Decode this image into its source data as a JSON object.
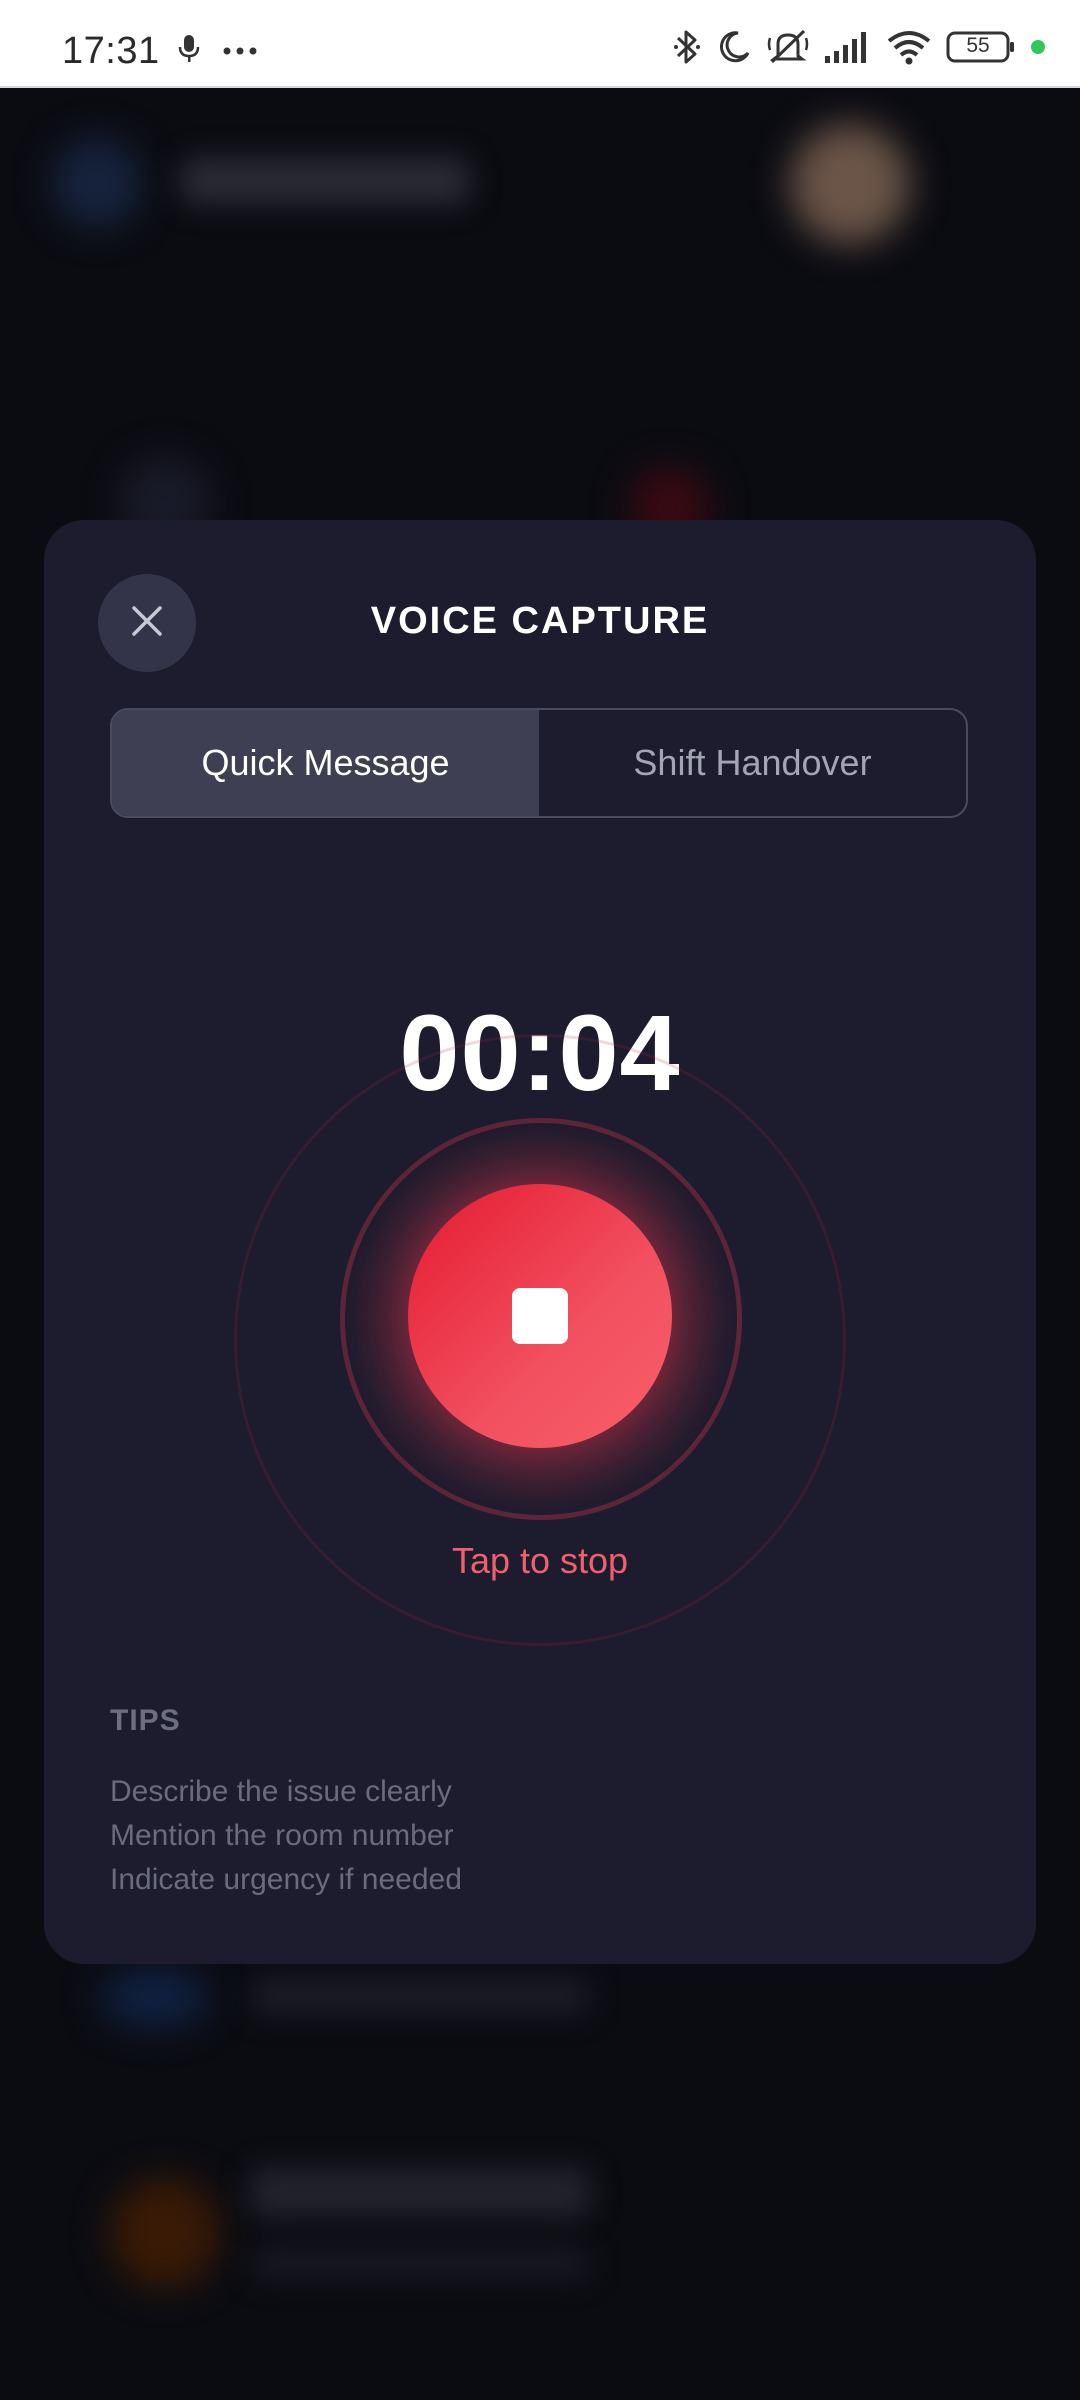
{
  "status_bar": {
    "time": "17:31",
    "battery": "55",
    "colors": {
      "indicator_dot": "#2fc95a"
    },
    "left_icons": [
      "microphone-icon",
      "more-dots-icon"
    ],
    "right_icons": [
      "bluetooth-icon",
      "moon-icon",
      "mute-icon",
      "signal-icon",
      "wifi-icon",
      "battery-icon"
    ]
  },
  "modal": {
    "title": "VOICE CAPTURE",
    "close_icon": "close-icon",
    "tabs": [
      {
        "label": "Quick Message",
        "active": true
      },
      {
        "label": "Shift Handover",
        "active": false
      }
    ],
    "timer": "00:04",
    "stop_icon": "stop-icon",
    "hint": "Tap to stop",
    "tips": {
      "title": "TIPS",
      "items": [
        "Describe the issue clearly",
        "Mention the room number",
        "Indicate urgency if needed"
      ]
    },
    "colors": {
      "background": "#1c1c2e",
      "accent": "#f0505e",
      "hint_text": "#f0606c"
    }
  }
}
